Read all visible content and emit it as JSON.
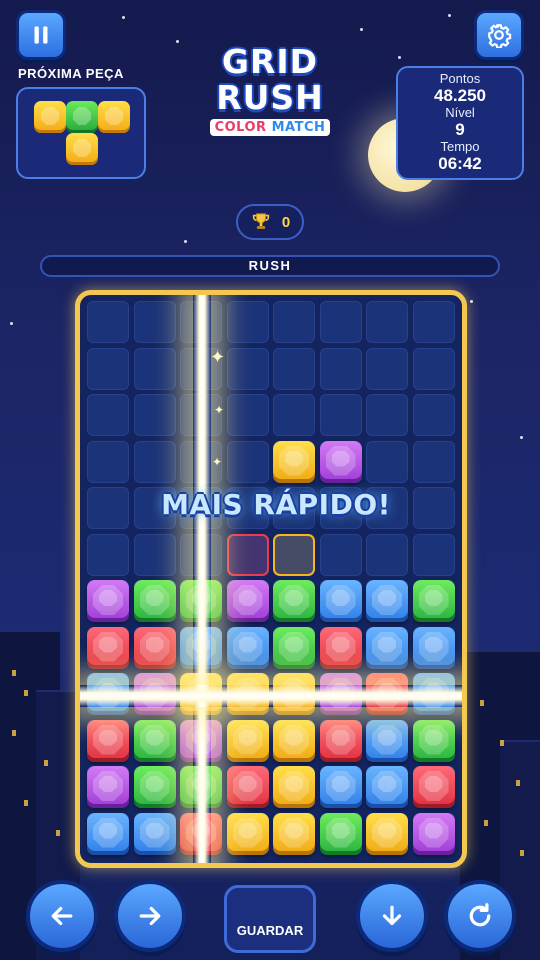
{
  "header": {
    "next_piece_label": "PRÓXIMA PEÇA",
    "logo": {
      "line1": "GRID",
      "line2": "RUSH",
      "subtitle_a": "COLOR",
      "subtitle_b": "MATCH"
    },
    "stats": {
      "points_label": "Pontos",
      "points_value": "48.250",
      "level_label": "Nível",
      "level_value": "9",
      "time_label": "Tempo",
      "time_value": "06:42"
    },
    "trophy_count": "0",
    "mode_label": "RUSH"
  },
  "next_piece": [
    {
      "color": "yellow"
    },
    {
      "color": "green"
    },
    {
      "color": "yellow"
    },
    {
      "color": "yellow"
    }
  ],
  "board": {
    "cols": 8,
    "rows": 12,
    "banner": "MAIS RÁPIDO!",
    "falling_piece": [
      {
        "row": 3,
        "col": 4,
        "color": "yellow"
      },
      {
        "row": 3,
        "col": 5,
        "color": "purple"
      }
    ],
    "ghost_cells": [
      {
        "row": 5,
        "col": 3,
        "color": "red"
      },
      {
        "row": 5,
        "col": 4,
        "color": "yellow"
      }
    ],
    "stack_rows": [
      [
        "purple",
        "green",
        "green",
        "purple",
        "green",
        "blue",
        "blue",
        "green"
      ],
      [
        "red",
        "red",
        "blue",
        "blue",
        "green",
        "red",
        "blue",
        "blue"
      ],
      [
        "blue",
        "purple",
        "yellow",
        "yellow",
        "yellow",
        "purple",
        "red",
        "blue"
      ],
      [
        "red",
        "green",
        "purple",
        "yellow",
        "yellow",
        "red",
        "blue",
        "green"
      ],
      [
        "purple",
        "green",
        "green",
        "red",
        "yellow",
        "blue",
        "blue",
        "red"
      ],
      [
        "blue",
        "blue",
        "red",
        "yellow",
        "yellow",
        "green",
        "yellow",
        "purple"
      ]
    ],
    "clear_column": 2,
    "clear_row": 8
  },
  "controls": {
    "save_label": "GUARDAR"
  },
  "colors": {
    "yellow": "#f5b51c",
    "green": "#33c04a",
    "purple": "#b04ce0",
    "red": "#ec3b4f",
    "blue": "#3a8ef0",
    "gold_border": "#f2c850"
  }
}
